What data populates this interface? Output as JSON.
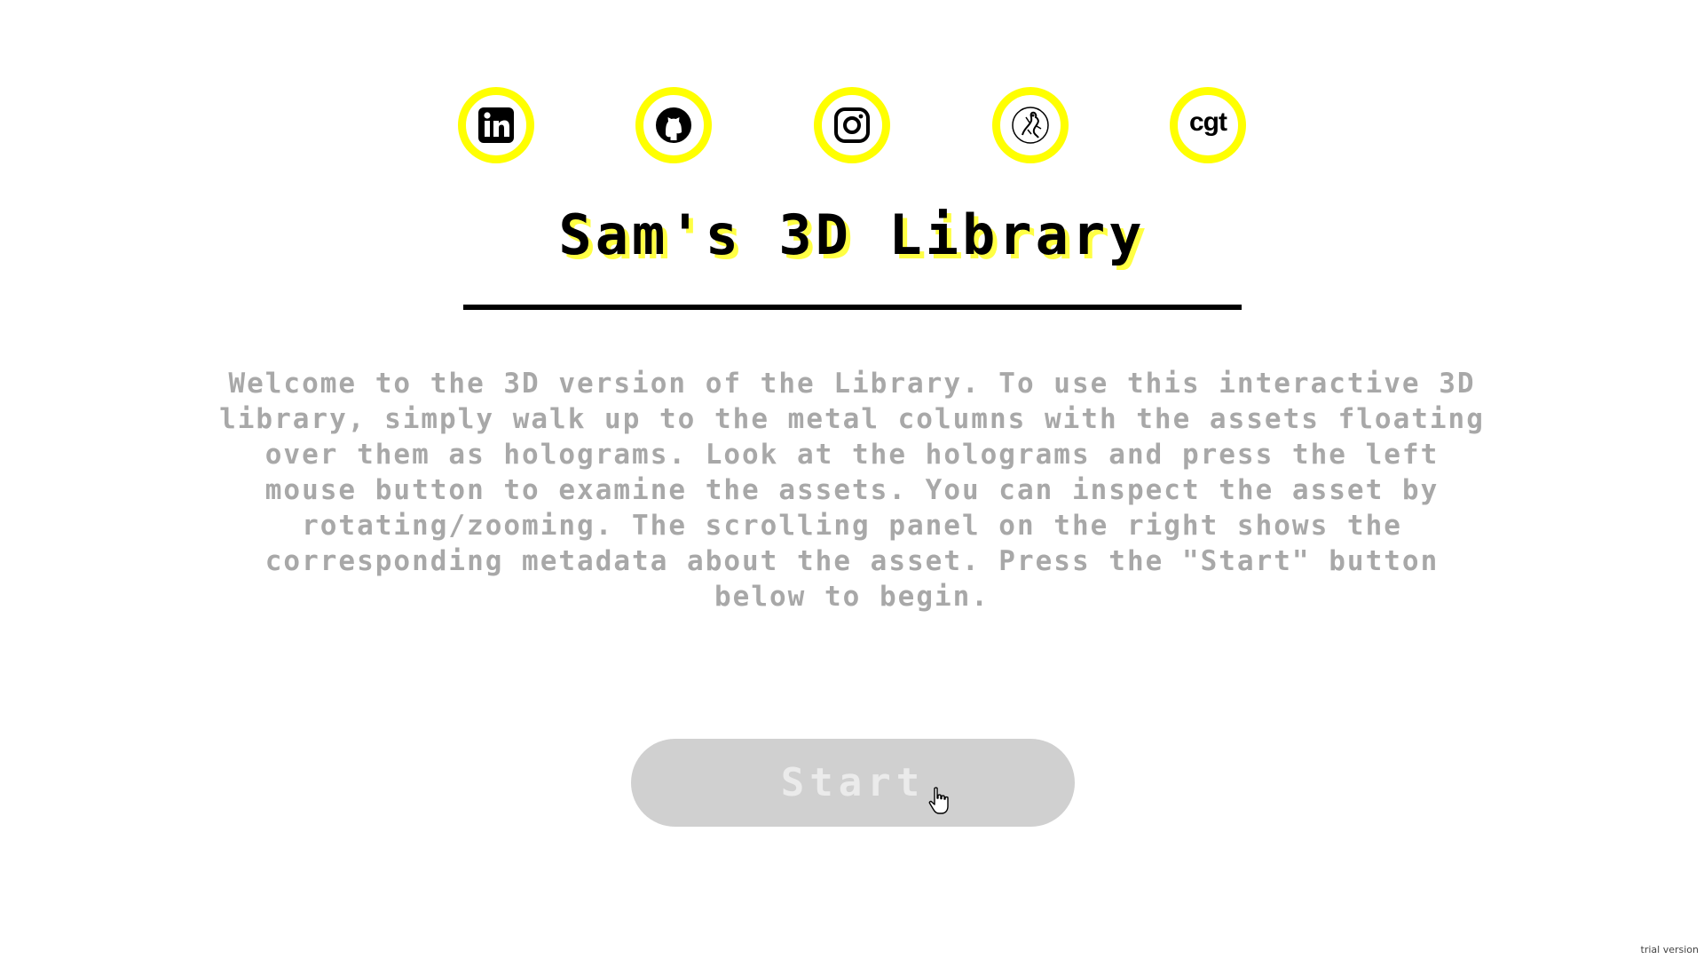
{
  "social_links": [
    {
      "name": "linkedin",
      "icon": "linkedin-icon"
    },
    {
      "name": "github",
      "icon": "github-icon"
    },
    {
      "name": "instagram",
      "icon": "instagram-icon"
    },
    {
      "name": "artstation-logo",
      "icon": "artist-emblem-icon"
    },
    {
      "name": "cgtrader",
      "icon": "cgt-logo-icon",
      "label": "cgt"
    }
  ],
  "header": {
    "title": "Sam's 3D Library"
  },
  "intro": {
    "text": "Welcome to the 3D version of the Library. To use this interactive 3D library, simply walk up to the metal columns with the assets floating over them as holograms. Look at the holograms and press the left mouse button to examine the assets. You can inspect the asset by rotating/zooming. The scrolling panel on the right shows the corresponding metadata about the asset. Press the \"Start\" button below to begin."
  },
  "start_button": {
    "label": "Start"
  },
  "watermark": {
    "text": "trial version"
  },
  "colors": {
    "accent": "#ffff00",
    "title_shadow": "#ffff44",
    "body_text": "#a8a8a8",
    "button_bg": "#d0d0d0",
    "button_text": "#ebebeb"
  }
}
